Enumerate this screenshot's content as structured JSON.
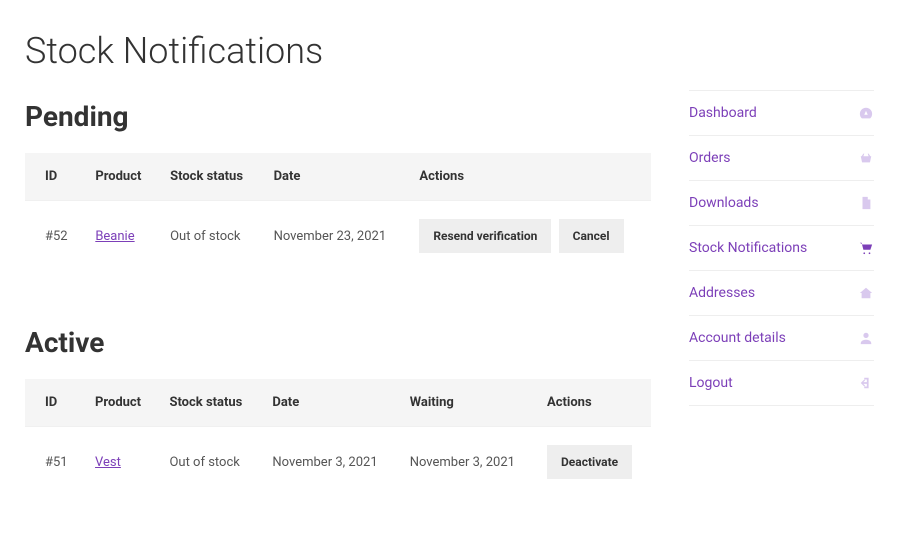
{
  "pageTitle": "Stock Notifications",
  "pending": {
    "heading": "Pending",
    "columns": {
      "id": "ID",
      "product": "Product",
      "stock": "Stock status",
      "date": "Date",
      "actions": "Actions"
    },
    "row": {
      "id": "#52",
      "product": "Beanie",
      "stock": "Out of stock",
      "date": "November 23, 2021",
      "resend": "Resend verification",
      "cancel": "Cancel"
    }
  },
  "active": {
    "heading": "Active",
    "columns": {
      "id": "ID",
      "product": "Product",
      "stock": "Stock status",
      "date": "Date",
      "waiting": "Waiting",
      "actions": "Actions"
    },
    "row": {
      "id": "#51",
      "product": "Vest",
      "stock": "Out of stock",
      "date": "November 3, 2021",
      "waiting": "November 3, 2021",
      "deactivate": "Deactivate"
    }
  },
  "sidebar": {
    "dashboard": "Dashboard",
    "orders": "Orders",
    "downloads": "Downloads",
    "stockNotifications": "Stock Notifications",
    "addresses": "Addresses",
    "accountDetails": "Account details",
    "logout": "Logout"
  },
  "colors": {
    "accent": "#7C3FB8"
  }
}
